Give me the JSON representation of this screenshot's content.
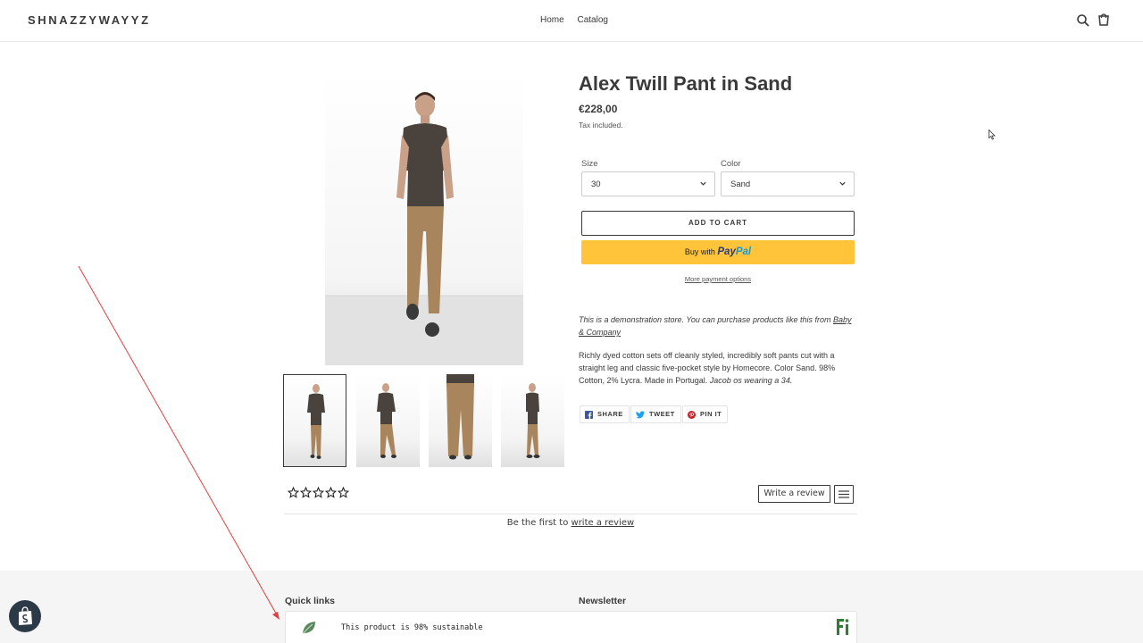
{
  "header": {
    "logo": "SHNAZZYWAYYZ",
    "nav": [
      "Home",
      "Catalog"
    ]
  },
  "product": {
    "title": "Alex Twill Pant in Sand",
    "price": "€228,00",
    "tax_note": "Tax included.",
    "size": {
      "label": "Size",
      "value": "30"
    },
    "color": {
      "label": "Color",
      "value": "Sand"
    },
    "add_to_cart": "ADD TO CART",
    "paypal": {
      "prefix": "Buy with",
      "brand_a": "Pay",
      "brand_b": "Pal"
    },
    "more_payment": "More payment options",
    "demo_text": "This is a demonstration store. You can purchase products like this from",
    "demo_link": "Baby & Company",
    "description": "Richly dyed cotton sets off cleanly styled, incredibly soft pants cut with a straight leg and classic five-pocket style by Homecore. Color Sand. 98% Cotton, 2% Lycra. Made in Portugal.",
    "description_italic": "Jacob os wearing a 34.",
    "share": {
      "facebook": "SHARE",
      "twitter": "TWEET",
      "pinterest": "PIN IT"
    }
  },
  "reviews": {
    "write_button": "Write a review",
    "empty_text": "Be the first to",
    "empty_link": "write a review"
  },
  "footer": {
    "quick_links": "Quick links",
    "newsletter": "Newsletter",
    "sustainability": "This product is 98% sustainable",
    "badge": "Fi"
  },
  "colors": {
    "paypal_bg": "#ffc439",
    "paypal_dark": "#253b80",
    "paypal_light": "#179bd7",
    "facebook": "#3b5998",
    "twitter": "#1da1f2",
    "pinterest": "#cb2027",
    "leaf": "#5a8a5c",
    "annotation": "#e04040"
  }
}
